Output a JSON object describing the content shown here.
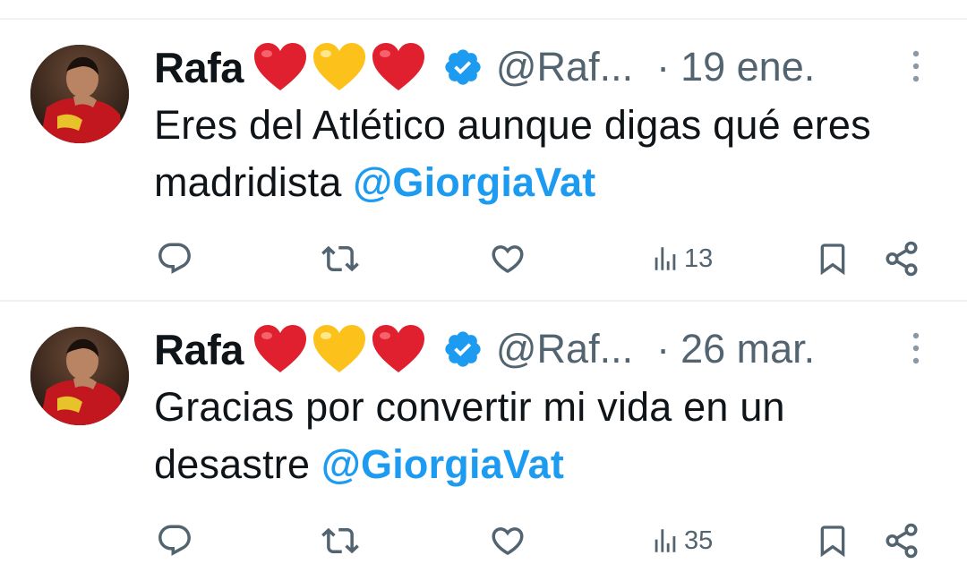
{
  "tweets": [
    {
      "author_name": "Rafa",
      "emoji_hearts": [
        "red-heart",
        "yellow-heart",
        "red-heart"
      ],
      "verified": true,
      "handle": "@Raf...",
      "separator": "·",
      "date": "19 ene.",
      "text_before": "Eres del Atlético aunque digas qué eres madridista ",
      "mention": "@GiorgiaVat",
      "views": "13"
    },
    {
      "author_name": "Rafa",
      "emoji_hearts": [
        "red-heart",
        "yellow-heart",
        "red-heart"
      ],
      "verified": true,
      "handle": "@Raf...",
      "separator": "·",
      "date": "26 mar.",
      "text_before": "Gracias por convertir mi vida en un desastre ",
      "mention": "@GiorgiaVat",
      "views": "35"
    }
  ],
  "colors": {
    "link": "#1d9bf0",
    "secondary_text": "#536471",
    "heart_red": "#e0202e",
    "heart_yellow": "#fcc21b",
    "verified_blue": "#1d9bf0"
  }
}
